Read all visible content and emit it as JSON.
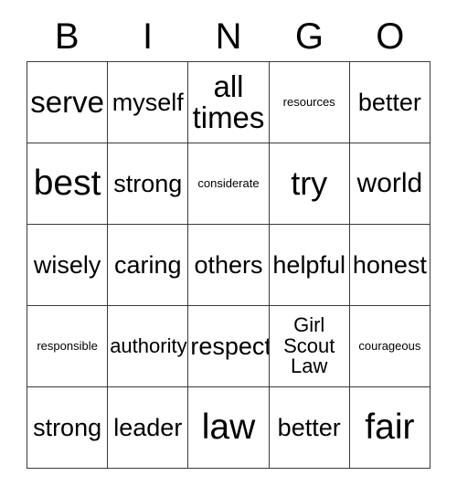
{
  "header": {
    "letters": [
      "B",
      "I",
      "N",
      "G",
      "O"
    ]
  },
  "grid": {
    "rows": [
      [
        {
          "text": "serve",
          "size": "fs-xl"
        },
        {
          "text": "myself",
          "size": "fs-md"
        },
        {
          "text": "all times",
          "size": "fs-xl"
        },
        {
          "text": "resources",
          "size": "fs-xs"
        },
        {
          "text": "better",
          "size": "fs-md"
        }
      ],
      [
        {
          "text": "best",
          "size": "fs-3xl"
        },
        {
          "text": "strong",
          "size": "fs-md"
        },
        {
          "text": "considerate",
          "size": "fs-xs"
        },
        {
          "text": "try",
          "size": "fs-2xl"
        },
        {
          "text": "world",
          "size": "fs-lg"
        }
      ],
      [
        {
          "text": "wisely",
          "size": "fs-md"
        },
        {
          "text": "caring",
          "size": "fs-md"
        },
        {
          "text": "others",
          "size": "fs-md"
        },
        {
          "text": "helpful",
          "size": "fs-md"
        },
        {
          "text": "honest",
          "size": "fs-md"
        }
      ],
      [
        {
          "text": "responsible",
          "size": "fs-xs"
        },
        {
          "text": "authority",
          "size": "fs-sm"
        },
        {
          "text": "respect",
          "size": "fs-md"
        },
        {
          "text": "Girl Scout Law",
          "size": "fs-sm"
        },
        {
          "text": "courageous",
          "size": "fs-xs"
        }
      ],
      [
        {
          "text": "strong",
          "size": "fs-md"
        },
        {
          "text": "leader",
          "size": "fs-md"
        },
        {
          "text": "law",
          "size": "fs-3xl"
        },
        {
          "text": "better",
          "size": "fs-md"
        },
        {
          "text": "fair",
          "size": "fs-3xl"
        }
      ]
    ]
  },
  "colors": {
    "background": "#ffffff",
    "text": "#000000",
    "border": "#3a3a3a"
  }
}
